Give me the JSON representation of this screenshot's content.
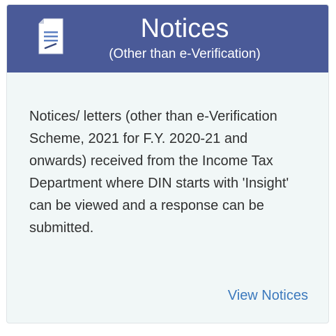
{
  "card": {
    "title": "Notices",
    "subtitle": "(Other than e-Verification)",
    "icon": "document-icon",
    "description": "Notices/ letters (other than e-Verification Scheme, 2021 for F.Y. 2020-21 and onwards) received from the Income Tax Department where DIN starts with 'Insight' can be viewed and a response can be submitted.",
    "link_label": "View Notices"
  },
  "colors": {
    "header_bg": "#4a5a98",
    "card_bg": "#f1f7f7",
    "link": "#3c79bd",
    "text": "#303030"
  }
}
